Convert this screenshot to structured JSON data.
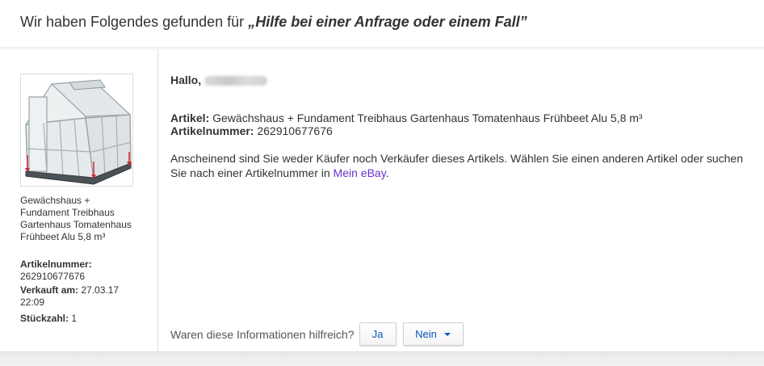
{
  "header": {
    "title_prefix": "Wir haben Folgendes gefunden für",
    "query": "„Hilfe bei einer Anfrage oder einem Fall”"
  },
  "item": {
    "title": "Gewächshaus + Fundament Treibhaus Gartenhaus Tomatenhaus Frühbeet Alu 5,8 m³",
    "article_number_label": "Artikelnummer:",
    "article_number": "262910677676",
    "sold_label": "Verkauft am:",
    "sold_date": "27.03.17 22:09",
    "quantity_label": "Stückzahl:",
    "quantity": "1"
  },
  "content": {
    "greeting": "Hallo,",
    "article_label": "Artikel:",
    "article_title": "Gewächshaus + Fundament Treibhaus Gartenhaus Tomatenhaus Frühbeet Alu 5,8 m³",
    "article_number_label": "Artikelnummer:",
    "article_number": "262910677676",
    "info_text": "Anscheinend sind Sie weder Käufer noch Verkäufer dieses Artikels. Wählen Sie einen anderen Artikel oder suchen Sie nach einer Artikelnummer in",
    "info_link": "Mein eBay",
    "info_end": "."
  },
  "feedback": {
    "question": "Waren diese Informationen hilfreich?",
    "yes_label": "Ja",
    "no_label": "Nein"
  },
  "colors": {
    "link": "#6633cc",
    "button_text": "#0654ba",
    "arrow_red": "#d0272c"
  }
}
